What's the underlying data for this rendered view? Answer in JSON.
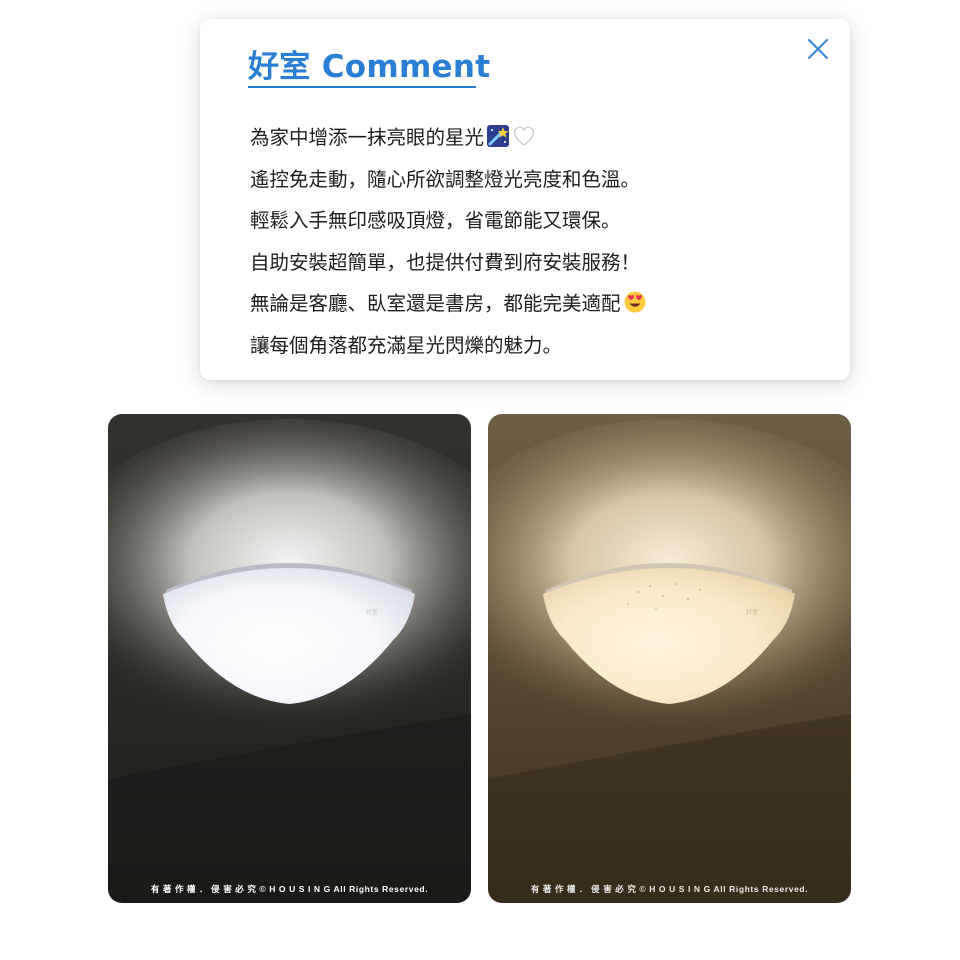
{
  "card": {
    "title": "好室 Comment",
    "close_icon": "close-icon",
    "lines": [
      {
        "text": "為家中增添一抹亮眼的星光",
        "emojis": [
          "shooting-star-emoji",
          "white-heart-emoji"
        ]
      },
      {
        "text": "遙控免走動，隨心所欲調整燈光亮度和色溫。",
        "emojis": []
      },
      {
        "text": "輕鬆入手無印感吸頂燈，省電節能又環保。",
        "emojis": []
      },
      {
        "text": "自助安裝超簡單，也提供付費到府安裝服務！",
        "emojis": []
      },
      {
        "text": "無論是客廳、臥室還是書房，都能完美適配",
        "emojis": [
          "heart-eyes-emoji"
        ]
      },
      {
        "text": "讓每個角落都充滿星光閃爍的魅力。",
        "emojis": []
      }
    ]
  },
  "photos": [
    {
      "name": "cool-white-light",
      "copyright": "有 著 作 權 ． 侵 害 必 究 © H O U S I N G All Rights Reserved."
    },
    {
      "name": "warm-light",
      "copyright": "有 著 作 權 ． 侵 害 必 究 © H O U S I N G All Rights Reserved."
    }
  ],
  "colors": {
    "title": "#2a7fd4",
    "body_text": "#1e1e1e",
    "close_icon": "#3a8ad8"
  }
}
